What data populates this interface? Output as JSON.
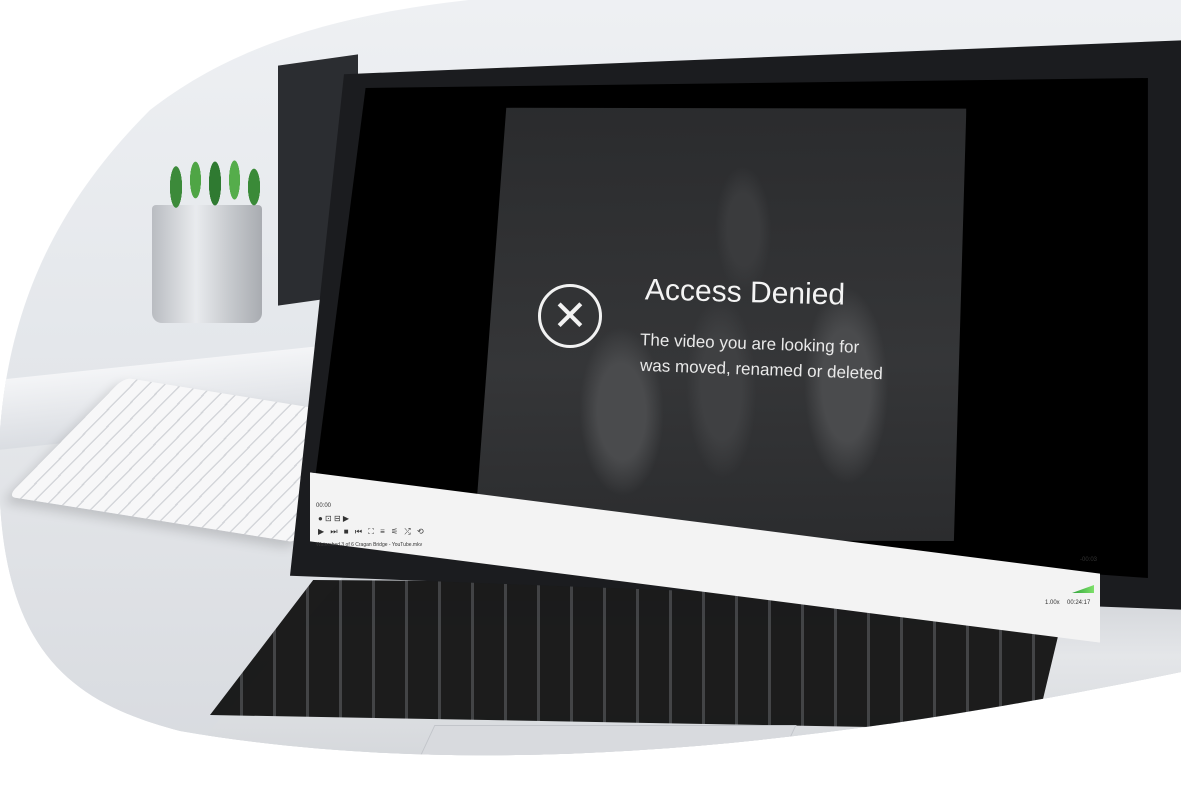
{
  "message": {
    "title": "Access Denied",
    "line1": "The video you are looking for",
    "line2": "was moved, renamed or deleted",
    "icon": "x-circle-icon"
  },
  "player": {
    "time_left": "00:00",
    "controls_row1": "● ⊡ ⊟ ▶",
    "controls_row2": "▶ ⏭ ■ ⏮ ⛶ ≡ ⚟ ⤮ ⟲",
    "filename": "Watershed 3 of 6 Cragan Bridge - YouTube.mkv",
    "time_right": "-00:03",
    "speed": "1.00x",
    "elapsed": "00:24:17"
  }
}
